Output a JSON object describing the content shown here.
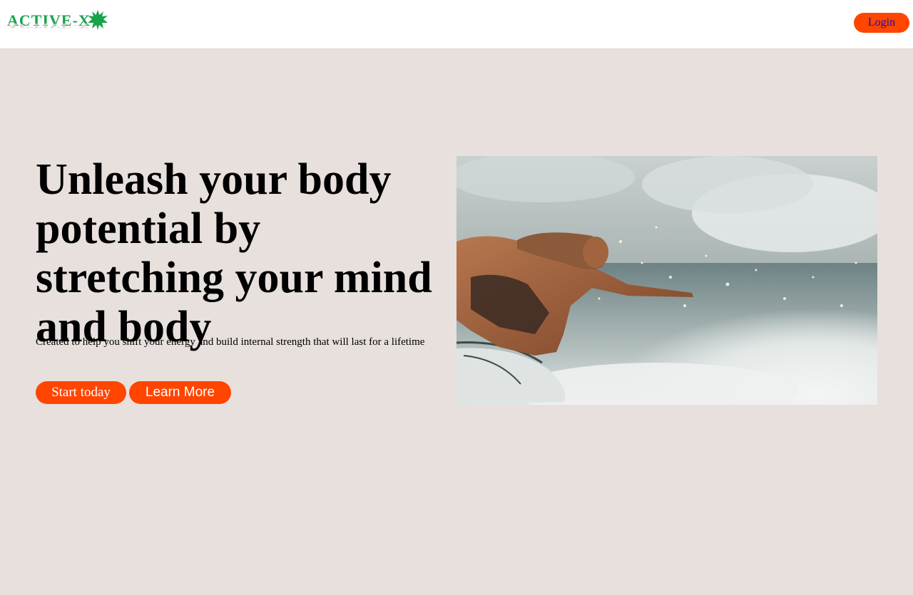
{
  "header": {
    "logo_text": "ACTIVE-X",
    "login_label": "Login"
  },
  "hero": {
    "title": "Unleash your body potential by stretching your mind and body",
    "subtitle": "Created to help you shift your energy and build internal strength that will last for a lifetime",
    "start_label": "Start today",
    "learn_label": "Learn More",
    "image_alt": "surfer-photo"
  },
  "colors": {
    "accent": "#ff4500",
    "logo_green": "#17a34a",
    "background": "#e7e0dc",
    "header_bg": "#ffffff",
    "login_text": "#1a0dab"
  }
}
